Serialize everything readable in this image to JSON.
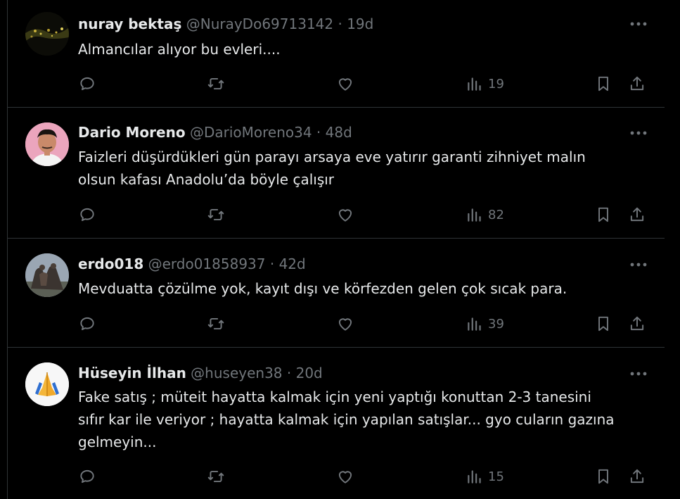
{
  "posts": [
    {
      "display_name": "nuray bektaş",
      "handle": "@NurayDo69713142",
      "separator": "·",
      "age": "19d",
      "text": "Almancılar alıyor bu evleri....",
      "views": "19",
      "avatar": "dark-landscape-photo"
    },
    {
      "display_name": "Dario Moreno",
      "handle": "@DarioMoreno34",
      "separator": "·",
      "age": "48d",
      "text": "Faizleri düşürdükleri gün parayı arsaya eve yatırır garanti zihniyet malın\nolsun kafası Anadolu’da böyle çalışır",
      "views": "82",
      "avatar": "portrait-photo"
    },
    {
      "display_name": "erdo018",
      "handle": "@erdo01858937",
      "separator": "·",
      "age": "42d",
      "text": "Mevduatta çözülme yok, kayıt dışı ve körfezden gelen çok sıcak para.",
      "views": "39",
      "avatar": "statue-photo"
    },
    {
      "display_name": "Hüseyin İlhan",
      "handle": "@huseyen38",
      "separator": "·",
      "age": "20d",
      "text": "Fake satış ; müteit hayatta kalmak için yeni yaptığı konuttan 2-3 tanesini\nsıfır kar ile veriyor ; hayatta kalmak için yapılan satışlar... gyo cuların gazına\ngelmeyin...",
      "views": "15",
      "avatar": "praying-hands-emoji"
    }
  ],
  "icons": [
    "reply-icon",
    "repost-icon",
    "like-icon",
    "views-icon",
    "bookmark-icon",
    "share-icon",
    "more-icon"
  ],
  "colors": {
    "background": "#000000",
    "text": "#e7e9ea",
    "muted": "#71767b",
    "divider": "#2f3336"
  }
}
